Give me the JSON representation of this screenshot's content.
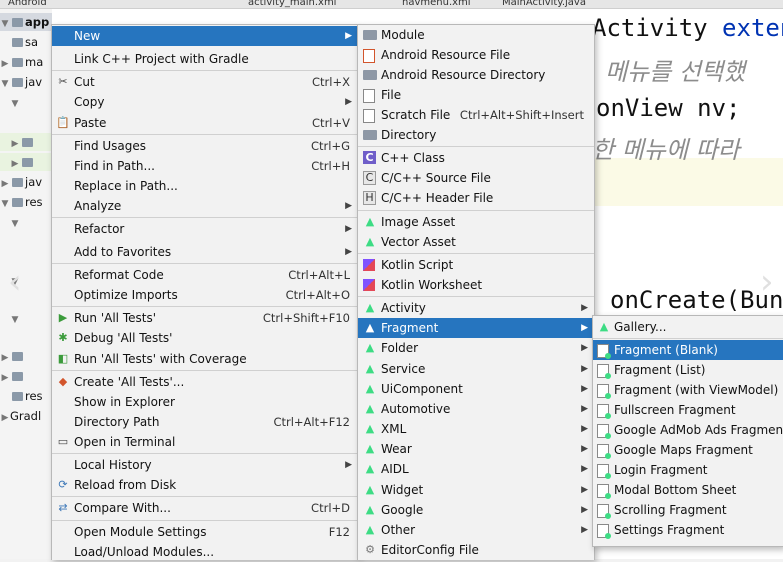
{
  "ide": {
    "tabs": [
      "Android",
      "activity_main.xml",
      "navmenu.xml",
      "MainActivity.java"
    ],
    "tree": [
      {
        "label": "app",
        "bold": true
      },
      {
        "label": "sa"
      },
      {
        "label": "ma"
      },
      {
        "label": "jav"
      },
      {
        "label": "jav"
      },
      {
        "label": "res"
      },
      {
        "label": "res"
      },
      {
        "label": "Gradl"
      }
    ],
    "code": {
      "line1_kw": "Activity",
      "line1_rest": "exten",
      "line2_comment": "메뉴를 선택했",
      "line3": "onView nv;",
      "line4_comment": "한 메뉴에 따라",
      "line5": "onCreate(Bun"
    }
  },
  "context_menu": {
    "items": [
      {
        "label": "New",
        "active": true,
        "submenu": true
      },
      {
        "label": "Link C++ Project with Gradle"
      },
      {
        "label": "Cut",
        "shortcut": "Ctrl+X",
        "icon": "cut-icon"
      },
      {
        "label": "Copy",
        "submenu": true
      },
      {
        "label": "Paste",
        "shortcut": "Ctrl+V",
        "icon": "paste-icon"
      },
      {
        "label": "Find Usages",
        "shortcut": "Ctrl+G"
      },
      {
        "label": "Find in Path...",
        "shortcut": "Ctrl+H"
      },
      {
        "label": "Replace in Path..."
      },
      {
        "label": "Analyze",
        "submenu": true
      },
      {
        "label": "Refactor",
        "submenu": true
      },
      {
        "label": "Add to Favorites",
        "submenu": true
      },
      {
        "label": "Reformat Code",
        "shortcut": "Ctrl+Alt+L"
      },
      {
        "label": "Optimize Imports",
        "shortcut": "Ctrl+Alt+O"
      },
      {
        "label": "Run 'All Tests'",
        "shortcut": "Ctrl+Shift+F10",
        "icon": "run-icon"
      },
      {
        "label": "Debug 'All Tests'",
        "icon": "debug-icon"
      },
      {
        "label": "Run 'All Tests' with Coverage",
        "icon": "coverage-icon"
      },
      {
        "label": "Create 'All Tests'...",
        "icon": "create-test-icon"
      },
      {
        "label": "Show in Explorer"
      },
      {
        "label": "Directory Path",
        "shortcut": "Ctrl+Alt+F12"
      },
      {
        "label": "Open in Terminal",
        "icon": "terminal-icon"
      },
      {
        "label": "Local History",
        "submenu": true
      },
      {
        "label": "Reload from Disk",
        "icon": "reload-icon"
      },
      {
        "label": "Compare With...",
        "shortcut": "Ctrl+D",
        "icon": "compare-icon"
      },
      {
        "label": "Open Module Settings",
        "shortcut": "F12"
      },
      {
        "label": "Load/Unload Modules..."
      }
    ]
  },
  "new_menu": {
    "items": [
      {
        "label": "Module",
        "icon": "folder-icon"
      },
      {
        "label": "Android Resource File",
        "icon": "resource-file-icon"
      },
      {
        "label": "Android Resource Directory",
        "icon": "folder-icon"
      },
      {
        "label": "File",
        "icon": "file-icon"
      },
      {
        "label": "Scratch File",
        "shortcut": "Ctrl+Alt+Shift+Insert",
        "icon": "scratch-file-icon"
      },
      {
        "label": "Directory",
        "icon": "folder-icon"
      },
      {
        "label": "C++ Class",
        "icon": "cpp-class-icon"
      },
      {
        "label": "C/C++ Source File",
        "icon": "cpp-source-icon"
      },
      {
        "label": "C/C++ Header File",
        "icon": "cpp-header-icon"
      },
      {
        "label": "Image Asset",
        "icon": "android-icon"
      },
      {
        "label": "Vector Asset",
        "icon": "android-icon"
      },
      {
        "label": "Kotlin Script",
        "icon": "kotlin-icon"
      },
      {
        "label": "Kotlin Worksheet",
        "icon": "kotlin-icon"
      },
      {
        "label": "Activity",
        "icon": "android-icon",
        "submenu": true
      },
      {
        "label": "Fragment",
        "icon": "android-icon",
        "submenu": true,
        "active": true
      },
      {
        "label": "Folder",
        "icon": "android-icon",
        "submenu": true
      },
      {
        "label": "Service",
        "icon": "android-icon",
        "submenu": true
      },
      {
        "label": "UiComponent",
        "icon": "android-icon",
        "submenu": true
      },
      {
        "label": "Automotive",
        "icon": "android-icon",
        "submenu": true
      },
      {
        "label": "XML",
        "icon": "android-icon",
        "submenu": true
      },
      {
        "label": "Wear",
        "icon": "android-icon",
        "submenu": true
      },
      {
        "label": "AIDL",
        "icon": "android-icon",
        "submenu": true
      },
      {
        "label": "Widget",
        "icon": "android-icon",
        "submenu": true
      },
      {
        "label": "Google",
        "icon": "android-icon",
        "submenu": true
      },
      {
        "label": "Other",
        "icon": "android-icon",
        "submenu": true
      },
      {
        "label": "EditorConfig File",
        "icon": "gear-icon"
      }
    ]
  },
  "fragment_menu": {
    "items": [
      {
        "label": "Gallery...",
        "icon": "android-icon"
      },
      {
        "label": "Fragment (Blank)",
        "icon": "fragment-icon",
        "active": true
      },
      {
        "label": "Fragment (List)",
        "icon": "fragment-icon"
      },
      {
        "label": "Fragment (with ViewModel)",
        "icon": "fragment-icon"
      },
      {
        "label": "Fullscreen Fragment",
        "icon": "fragment-icon"
      },
      {
        "label": "Google AdMob Ads Fragment",
        "icon": "fragment-icon"
      },
      {
        "label": "Google Maps Fragment",
        "icon": "fragment-icon"
      },
      {
        "label": "Login Fragment",
        "icon": "fragment-icon"
      },
      {
        "label": "Modal Bottom Sheet",
        "icon": "fragment-icon"
      },
      {
        "label": "Scrolling Fragment",
        "icon": "fragment-icon"
      },
      {
        "label": "Settings Fragment",
        "icon": "fragment-icon"
      }
    ]
  },
  "colors": {
    "highlight": "#2675bf",
    "menu_bg": "#f2f2f2",
    "android_green": "#3ddc84"
  }
}
